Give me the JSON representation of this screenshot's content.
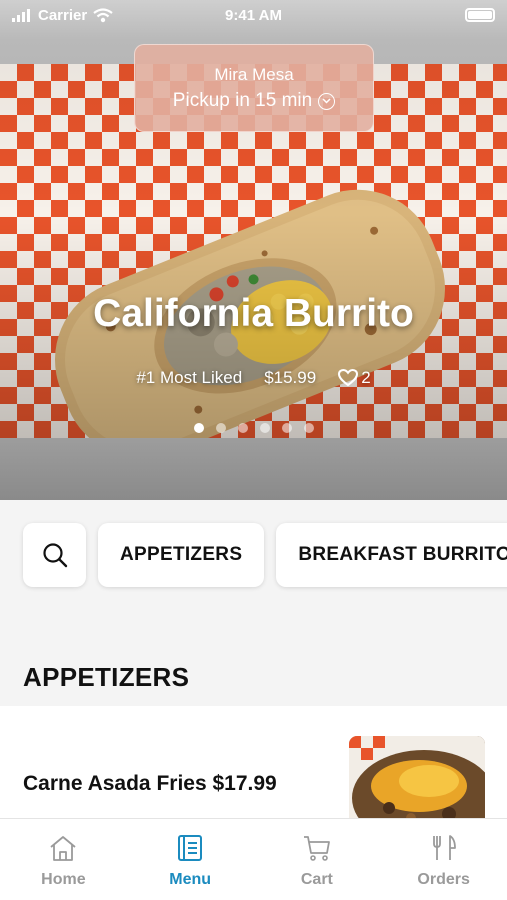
{
  "status_bar": {
    "carrier": "Carrier",
    "time": "9:41 AM"
  },
  "pickup": {
    "location": "Mira Mesa",
    "time_label": "Pickup in 15 min"
  },
  "hero": {
    "title": "California Burrito",
    "badge": "#1 Most Liked",
    "price": "$15.99",
    "likes": "2",
    "slide_count": 6,
    "active_slide": 1
  },
  "categories": {
    "items": [
      "APPETIZERS",
      "BREAKFAST BURRITOS"
    ]
  },
  "section": {
    "title": "APPETIZERS"
  },
  "menu_items": [
    {
      "name": "Carne Asada Fries $17.99"
    }
  ],
  "tab_bar": {
    "tabs": [
      {
        "label": "Home",
        "icon": "home-icon"
      },
      {
        "label": "Menu",
        "icon": "menu-book-icon",
        "active": true
      },
      {
        "label": "Cart",
        "icon": "cart-icon"
      },
      {
        "label": "Orders",
        "icon": "fork-knife-icon"
      }
    ]
  },
  "colors": {
    "accent": "#1b8bbf",
    "checker": "#e8542b",
    "pickup_pill": "#e2afa0"
  }
}
